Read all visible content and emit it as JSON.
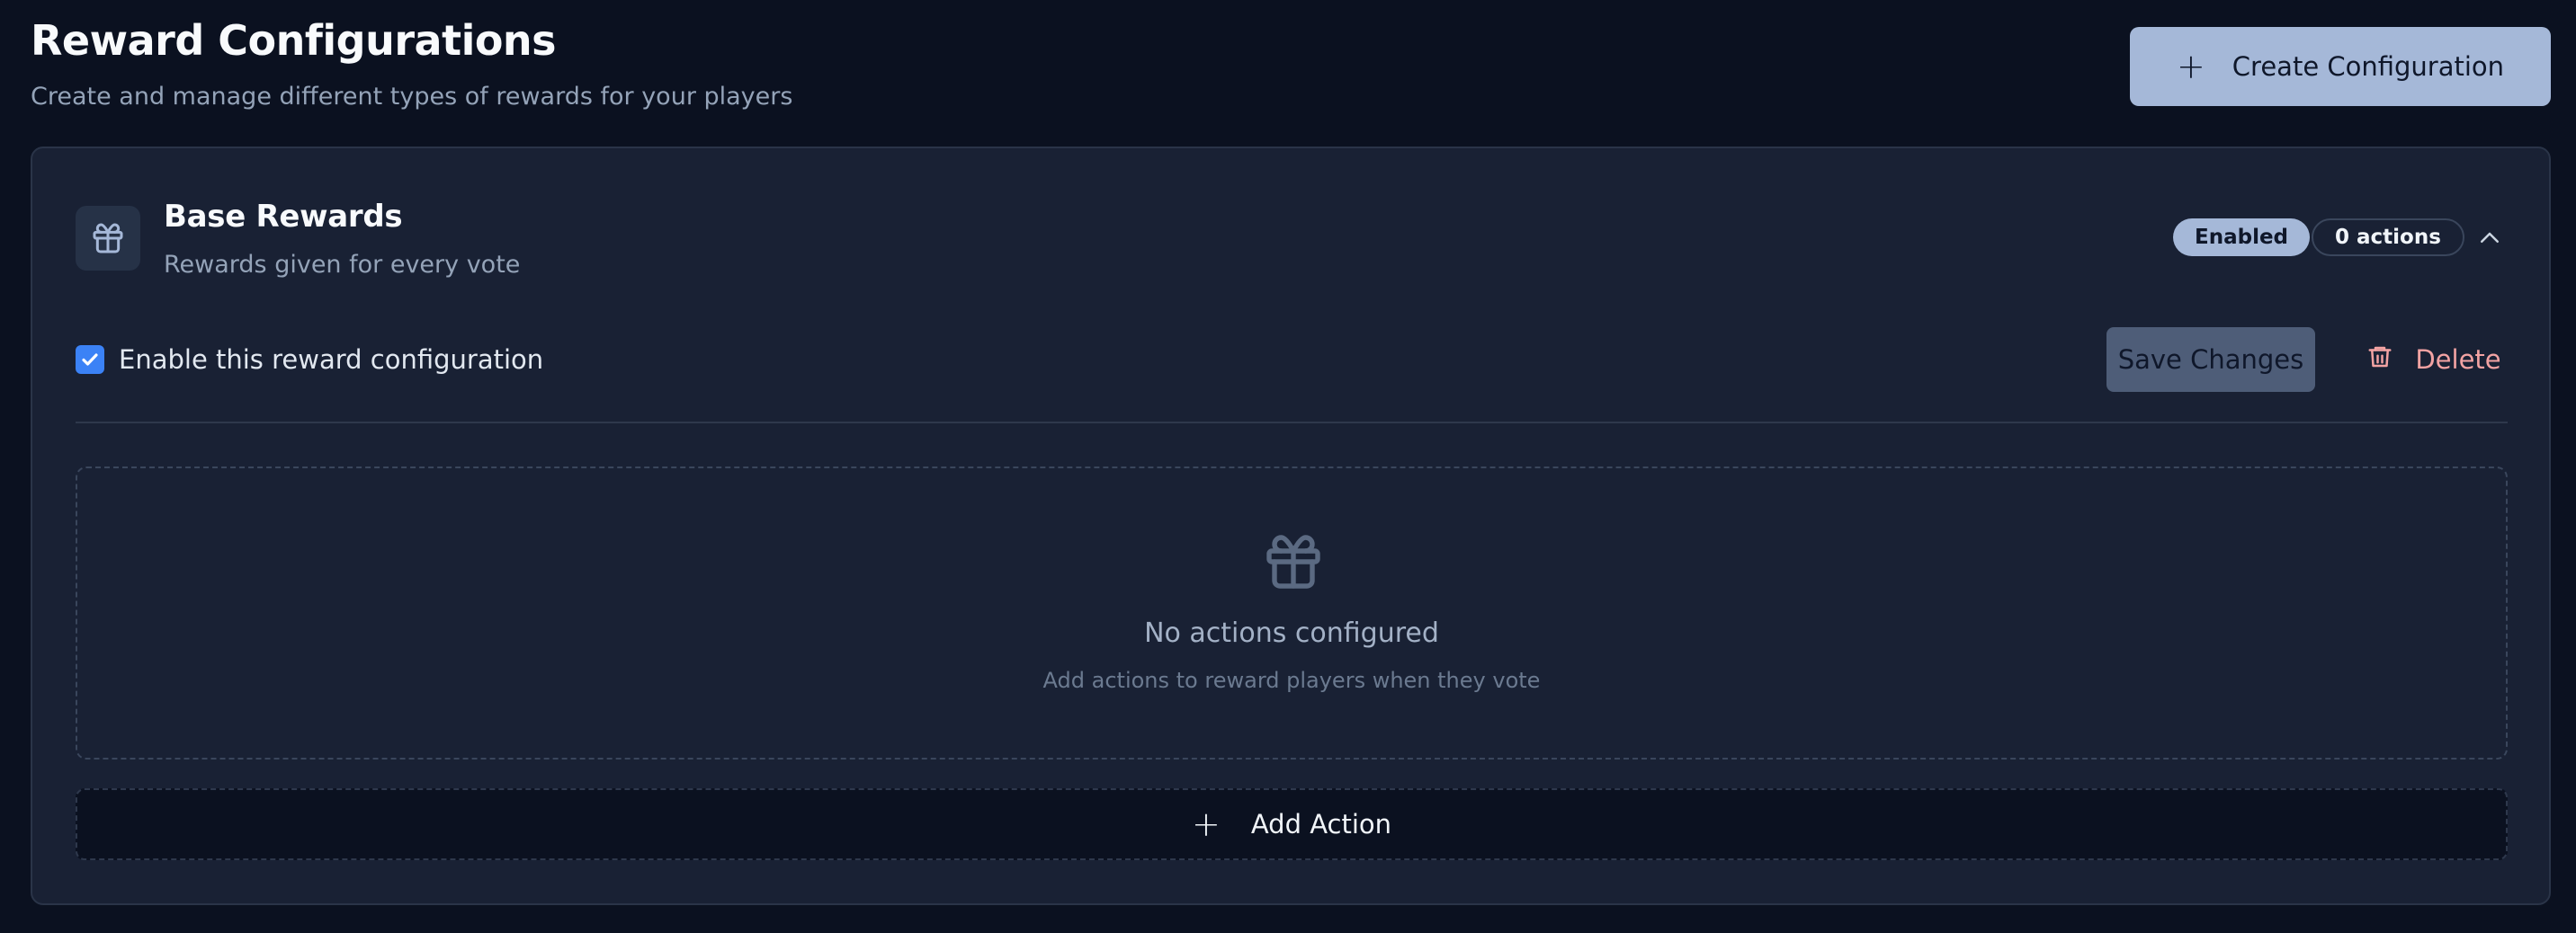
{
  "header": {
    "title": "Reward Configurations",
    "subtitle": "Create and manage different types of rewards for your players",
    "create_button": {
      "icon": "plus-icon",
      "label": "Create Configuration"
    }
  },
  "config": {
    "icon": "gift-icon",
    "title": "Base Rewards",
    "description": "Rewards given for every vote",
    "status_badge": "Enabled",
    "actions_badge": "0 actions",
    "collapse_icon": "chevron-up-icon",
    "enable_checkbox": {
      "checked": true,
      "label": "Enable this reward configuration"
    },
    "save_button": "Save Changes",
    "delete_button": {
      "icon": "trash-icon",
      "label": "Delete"
    },
    "empty_state": {
      "icon": "gift-icon",
      "title": "No actions configured",
      "subtitle": "Add actions to reward players when they vote"
    },
    "add_action_button": {
      "icon": "plus-icon",
      "label": "Add Action"
    }
  },
  "colors": {
    "background": "#0b1120",
    "card": "#192134",
    "primary": "#a5b8d8",
    "checkbox": "#3b82f6",
    "danger": "#f3a3a3"
  }
}
